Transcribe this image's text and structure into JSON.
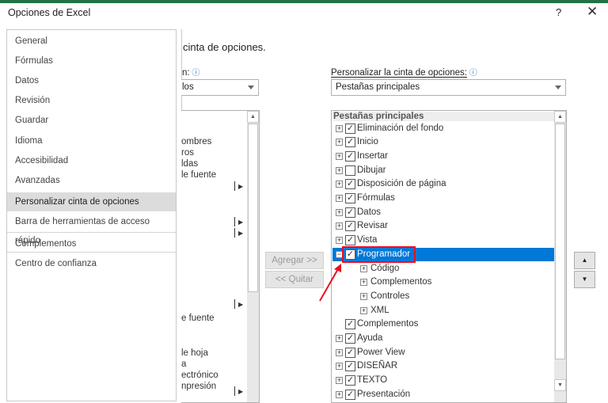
{
  "window": {
    "title": "Opciones de Excel",
    "help": "?",
    "close": "✕",
    "accent": "#217346"
  },
  "sidebar": {
    "items": [
      {
        "label": "General"
      },
      {
        "label": "Fórmulas"
      },
      {
        "label": "Datos"
      },
      {
        "label": "Revisión"
      },
      {
        "label": "Guardar"
      },
      {
        "label": "Idioma"
      },
      {
        "label": "Accesibilidad"
      },
      {
        "label": "Avanzadas"
      },
      {
        "label": "Personalizar cinta de opciones",
        "selected": true
      },
      {
        "label": "Barra de herramientas de acceso rápido"
      },
      {
        "label": "Complementos"
      },
      {
        "label": "Centro de confianza"
      }
    ]
  },
  "main": {
    "heading": "cinta de opciones.",
    "left_label": "n:",
    "left_dropdown": "los",
    "left_list": [
      "ombres",
      "ros",
      "ldas",
      "le fuente",
      "e fuente",
      "le hoja",
      "a",
      "ectrónico",
      "npresión"
    ],
    "right_label": "Personalizar la cinta de opciones:",
    "right_dropdown": "Pestañas principales",
    "add_button": "Agregar >>",
    "remove_button": "<< Quitar",
    "tree_header": "Pestañas principales",
    "tree": [
      {
        "label": "Eliminación del fondo",
        "checked": true
      },
      {
        "label": "Inicio",
        "checked": true
      },
      {
        "label": "Insertar",
        "checked": true
      },
      {
        "label": "Dibujar",
        "checked": false
      },
      {
        "label": "Disposición de página",
        "checked": true
      },
      {
        "label": "Fórmulas",
        "checked": true
      },
      {
        "label": "Datos",
        "checked": true
      },
      {
        "label": "Revisar",
        "checked": true
      },
      {
        "label": "Vista",
        "checked": true
      },
      {
        "label": "Programador",
        "checked": true,
        "selected": true,
        "expanded": true
      },
      {
        "label": "Código",
        "child": true
      },
      {
        "label": "Complementos",
        "child": true
      },
      {
        "label": "Controles",
        "child": true
      },
      {
        "label": "XML",
        "child": true
      },
      {
        "label": "Complementos",
        "checked": true,
        "noexpander": true
      },
      {
        "label": "Ayuda",
        "checked": true
      },
      {
        "label": "Power View",
        "checked": true
      },
      {
        "label": "DISEÑAR",
        "checked": true
      },
      {
        "label": "TEXTO",
        "checked": true
      },
      {
        "label": "Presentación",
        "checked": true
      }
    ],
    "selection_color": "#0078d7",
    "highlight_color": "#e81123"
  }
}
